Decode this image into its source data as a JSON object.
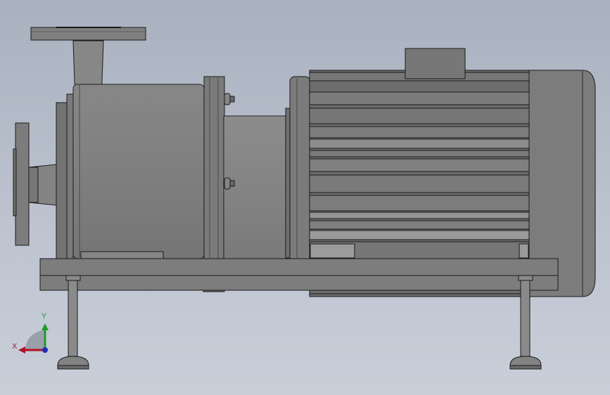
{
  "viewport": {
    "background_top": "#a9b1bf",
    "background_bottom": "#c9cfd9"
  },
  "model": {
    "name": "",
    "view": "front",
    "body_color": "#7b7b7b",
    "edge_color": "#1a1a1a"
  },
  "triad": {
    "x_label": "X",
    "y_label": "Y",
    "x_color": "#b0102a",
    "y_color": "#1f9b2a",
    "z_color": "#1b2fb0"
  }
}
